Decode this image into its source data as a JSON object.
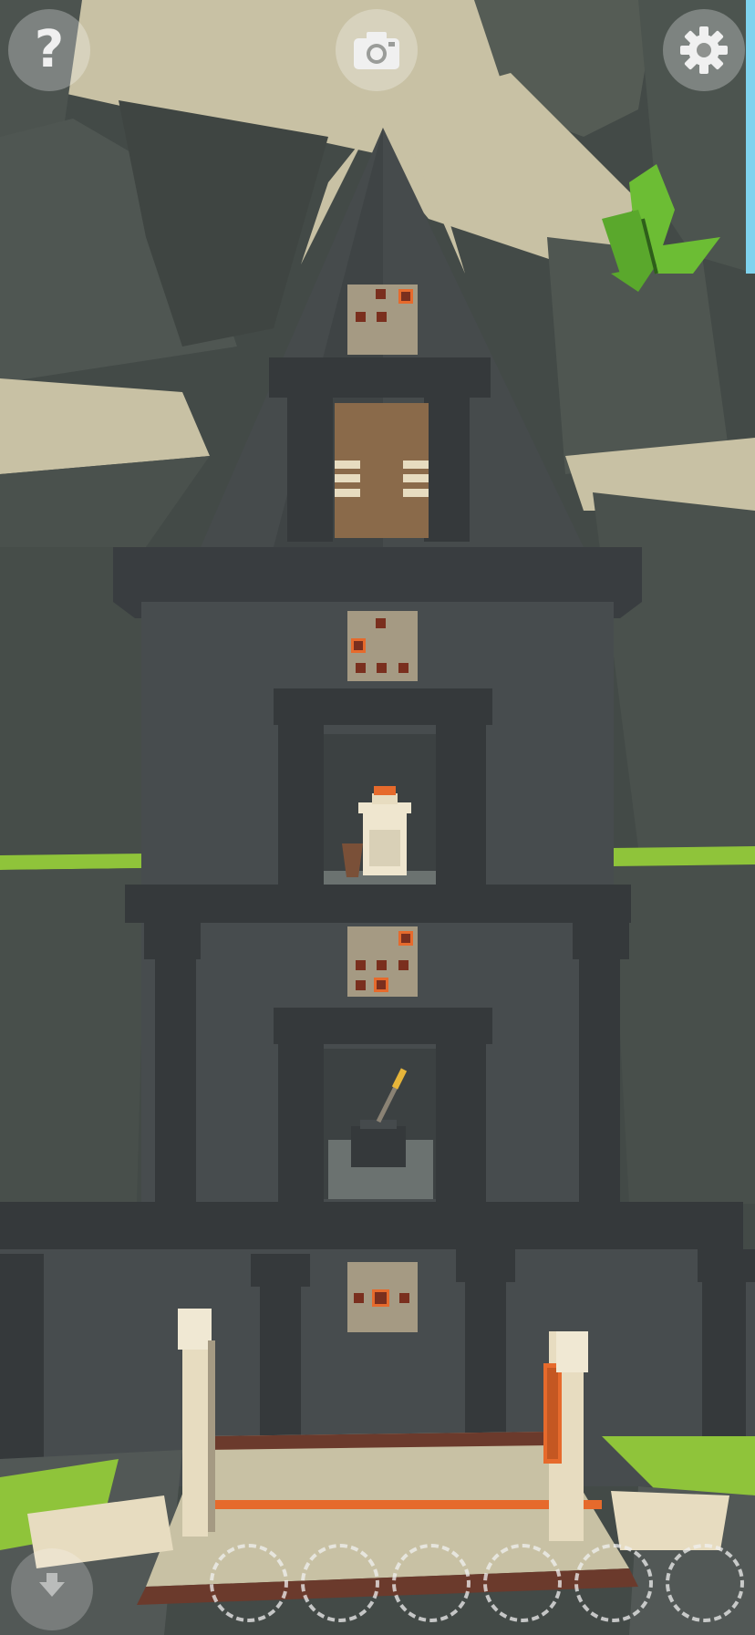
{
  "hud": {
    "help_label": "?",
    "camera_icon": "camera-icon",
    "settings_icon": "gear-icon",
    "back_icon": "back-arrow-icon"
  },
  "inventory": {
    "slots": [
      "",
      "",
      "",
      "",
      "",
      ""
    ]
  },
  "colors": {
    "stone_dark": "#3a3e40",
    "stone_mid": "#4a4f50",
    "cliff": "#4f5651",
    "sand": "#c9c2a6",
    "grass": "#8fc43a",
    "plaque": "#a59a83",
    "dot": "#7a2f1e",
    "dot_lit": "#e66a2c",
    "wood_door": "#8a6a4a"
  }
}
